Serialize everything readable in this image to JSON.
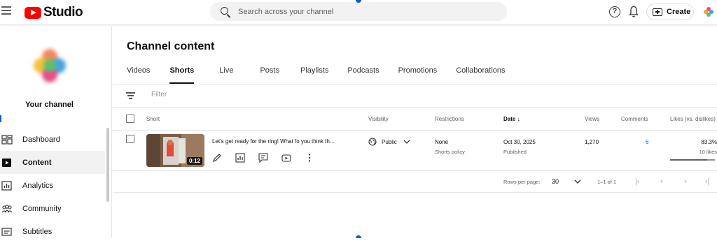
{
  "app": {
    "logo_text": "Studio"
  },
  "search": {
    "placeholder": "Search across your channel"
  },
  "header": {
    "create_label": "Create"
  },
  "sidebar": {
    "channel_label": "Your channel",
    "items": [
      {
        "label": "Dashboard",
        "icon": "dashboard-icon"
      },
      {
        "label": "Content",
        "icon": "content-icon"
      },
      {
        "label": "Analytics",
        "icon": "analytics-icon"
      },
      {
        "label": "Community",
        "icon": "community-icon"
      },
      {
        "label": "Subtitles",
        "icon": "subtitles-icon"
      }
    ]
  },
  "main": {
    "title": "Channel content",
    "tabs": [
      "Videos",
      "Shorts",
      "Live",
      "Posts",
      "Playlists",
      "Podcasts",
      "Promotions",
      "Collaborations"
    ],
    "active_tab": "Shorts",
    "filter_placeholder": "Filter"
  },
  "table": {
    "headers": {
      "short": "Short",
      "visibility": "Visibility",
      "restrictions": "Restrictions",
      "date": "Date",
      "views": "Views",
      "comments": "Comments",
      "likes": "Likes (vs. dislikes)"
    },
    "rows": [
      {
        "title": "Let's get ready for the ring! What fo you think th...",
        "duration": "0:12",
        "visibility": "Public",
        "restriction": "None",
        "restriction_sub": "Shorts policy",
        "date": "Oct 30, 2025",
        "date_sub": "Published",
        "views": "1,270",
        "comments": "6",
        "likes_pct": "83.3%",
        "likes_sub": "10 likes",
        "likes_ratio": 0.833
      }
    ]
  },
  "pagination": {
    "rows_per_page_label": "Rows per page:",
    "rows_per_page": "30",
    "range": "1–1 of 1"
  },
  "colors": {
    "brand_red": "#ff0000",
    "link_blue": "#065fd4"
  }
}
